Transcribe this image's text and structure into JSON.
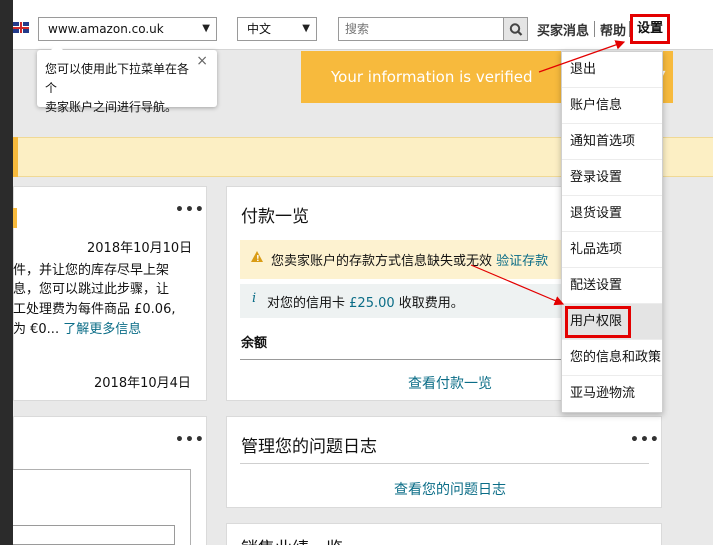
{
  "topbar": {
    "marketplace": "www.amazon.co.uk",
    "language": "中文",
    "search_placeholder": "搜索",
    "buyer_messages": "买家消息",
    "help": "帮助",
    "settings": "设置"
  },
  "tooltip": {
    "text_line1": "您可以使用此下拉菜单在各个",
    "text_line2": "卖家账户之间进行导航。",
    "close": "×"
  },
  "banner": {
    "verified_text": "Your information is verified"
  },
  "left_card": {
    "date1": "2018年10月10日",
    "line1": "件，并让您的库存尽早上架",
    "line2": "息，您可以跳过此步骤，让",
    "line3": "工处理费为每件商品 £0.06,",
    "line4_prefix": "为 €0...",
    "line4_link": "了解更多信息",
    "date2": "2018年10月4日",
    "menu": "•••"
  },
  "left_card_2": {
    "menu": "•••"
  },
  "payment_card": {
    "title": "付款一览",
    "menu": "•••",
    "warning_text": "您卖家账户的存款方式信息缺失或无效",
    "warning_link": "验证存款",
    "info_icon": "i",
    "info_prefix": "对您的信用卡",
    "info_amount": "£25.00",
    "info_suffix": "收取费用。",
    "balance_label": "余额",
    "view_link": "查看付款一览"
  },
  "issues_card": {
    "title": "管理您的问题日志",
    "menu": "•••",
    "view_link": "查看您的问题日志"
  },
  "sales_card": {
    "title": "销售业绩一览"
  },
  "settings_menu": {
    "items": [
      "退出",
      "账户信息",
      "通知首选项",
      "登录设置",
      "退货设置",
      "礼品选项",
      "配送设置",
      "用户权限",
      "您的信息和政策",
      "亚马逊物流"
    ],
    "highlighted": "用户权限"
  },
  "colors": {
    "accent_orange": "#f7ba3d",
    "link_teal": "#0b6d87",
    "annotation_red": "#e30000"
  }
}
